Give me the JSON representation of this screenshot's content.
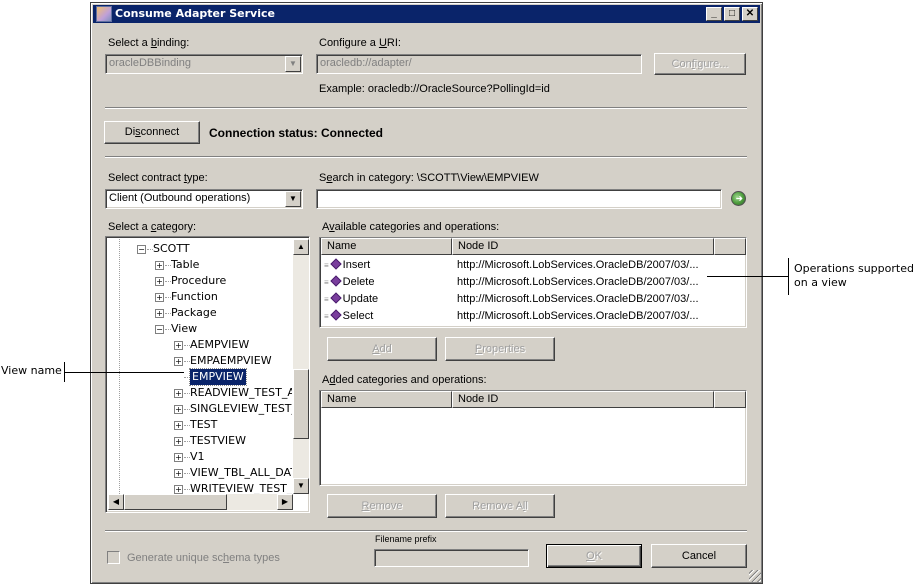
{
  "window": {
    "title": "Consume Adapter Service",
    "controls": {
      "minimize": "_",
      "maximize": "□",
      "close": "✕"
    }
  },
  "binding": {
    "label_pre": "Select a ",
    "label_u": "b",
    "label_post": "inding:",
    "value": "oracleDBBinding"
  },
  "uri": {
    "label_pre": "Configure a ",
    "label_u": "U",
    "label_post": "RI:",
    "value": "oracledb://adapter/",
    "configure_pre": "Con",
    "configure_u": "f",
    "configure_post": "igure...",
    "example": "Example: oracledb://OracleSource?PollingId=id"
  },
  "connection": {
    "disconnect_pre": "Di",
    "disconnect_u": "s",
    "disconnect_post": "connect",
    "status": "Connection status: Connected"
  },
  "contract": {
    "label_pre": "Select contract ",
    "label_u": "t",
    "label_post": "ype:",
    "value": "Client (Outbound operations)"
  },
  "search": {
    "label_pre": "S",
    "label_u": "e",
    "label_post": "arch in category: \\SCOTT\\View\\EMPVIEW",
    "value": "",
    "go_icon": "go-arrow-icon"
  },
  "category": {
    "label_pre": "Select a ",
    "label_u": "c",
    "label_post": "ategory:",
    "tree": [
      {
        "label": "SCOTT",
        "level": 0,
        "expander": "−"
      },
      {
        "label": "Table",
        "level": 1,
        "expander": "+"
      },
      {
        "label": "Procedure",
        "level": 1,
        "expander": "+"
      },
      {
        "label": "Function",
        "level": 1,
        "expander": "+"
      },
      {
        "label": "Package",
        "level": 1,
        "expander": "+"
      },
      {
        "label": "View",
        "level": 1,
        "expander": "−"
      },
      {
        "label": "AEMPVIEW",
        "level": 2,
        "expander": "+"
      },
      {
        "label": "EMPAEMPVIEW",
        "level": 2,
        "expander": "+"
      },
      {
        "label": "EMPVIEW",
        "level": 2,
        "expander": "",
        "selected": true
      },
      {
        "label": "READVIEW_TEST_A",
        "level": 2,
        "expander": "+"
      },
      {
        "label": "SINGLEVIEW_TEST_",
        "level": 2,
        "expander": "+"
      },
      {
        "label": "TEST",
        "level": 2,
        "expander": "+"
      },
      {
        "label": "TESTVIEW",
        "level": 2,
        "expander": "+"
      },
      {
        "label": "V1",
        "level": 2,
        "expander": "+"
      },
      {
        "label": "VIEW_TBL_ALL_DAT",
        "level": 2,
        "expander": "+"
      },
      {
        "label": "WRITEVIEW_TEST_/",
        "level": 2,
        "expander": "+"
      }
    ]
  },
  "available": {
    "label_pre": "A",
    "label_u": "v",
    "label_post": "ailable categories and operations:",
    "columns": [
      "Name",
      "Node ID"
    ],
    "rows": [
      {
        "name": "Insert",
        "node_id": "http://Microsoft.LobServices.OracleDB/2007/03/..."
      },
      {
        "name": "Delete",
        "node_id": "http://Microsoft.LobServices.OracleDB/2007/03/..."
      },
      {
        "name": "Update",
        "node_id": "http://Microsoft.LobServices.OracleDB/2007/03/..."
      },
      {
        "name": "Select",
        "node_id": "http://Microsoft.LobServices.OracleDB/2007/03/..."
      }
    ],
    "add_pre": "",
    "add_u": "A",
    "add_post": "dd",
    "properties_pre": "",
    "properties_u": "P",
    "properties_post": "roperties"
  },
  "added": {
    "label_pre": "A",
    "label_u": "d",
    "label_post": "ded categories and operations:",
    "columns": [
      "Name",
      "Node ID"
    ],
    "rows": [],
    "remove_pre": "",
    "remove_u": "R",
    "remove_post": "emove",
    "remove_all_pre": "Remove A",
    "remove_all_u": "l",
    "remove_all_post": "l"
  },
  "footer": {
    "generate_pre": "Generate unique sc",
    "generate_u": "h",
    "generate_post": "ema types",
    "generate_checked": false,
    "filename_prefix_label": "Filename prefix",
    "filename_prefix_value": "",
    "ok_pre": "",
    "ok_u": "O",
    "ok_post": "K",
    "cancel": "Cancel"
  },
  "callouts": {
    "operations": "Operations supported on a view",
    "operations_line1": "Operations supported",
    "operations_line2": "on a view",
    "view_name": "View name"
  }
}
